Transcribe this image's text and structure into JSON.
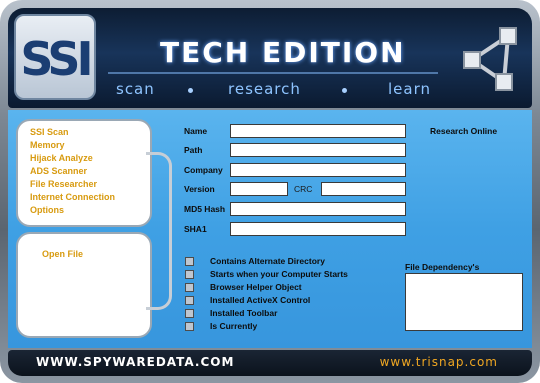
{
  "app": {
    "title": "TECH EDITION",
    "logo_text": "SSI",
    "taglines": [
      "scan",
      "research",
      "learn"
    ]
  },
  "nav": {
    "items": [
      {
        "label": "SSI Scan"
      },
      {
        "label": "Memory"
      },
      {
        "label": "Hijack Analyze"
      },
      {
        "label": "ADS Scanner"
      },
      {
        "label": "File Researcher"
      },
      {
        "label": "Internet Connection"
      },
      {
        "label": "Options"
      }
    ],
    "open_file_label": "Open File"
  },
  "form": {
    "name_label": "Name",
    "name_value": "",
    "path_label": "Path",
    "path_value": "",
    "company_label": "Company",
    "company_value": "",
    "version_label": "Version",
    "version_value": "",
    "crc_label": "CRC",
    "crc_value": "",
    "md5_label": "MD5 Hash",
    "md5_value": "",
    "sha1_label": "SHA1",
    "sha1_value": "",
    "research_online_label": "Research Online"
  },
  "checkboxes": [
    {
      "label": "Contains Alternate Directory",
      "checked": false
    },
    {
      "label": "Starts when your Computer Starts",
      "checked": false
    },
    {
      "label": "Browser Helper Object",
      "checked": false
    },
    {
      "label": "Installed ActiveX Control",
      "checked": false
    },
    {
      "label": "Installed Toolbar",
      "checked": false
    },
    {
      "label": "Is Currently",
      "checked": false
    }
  ],
  "dependency": {
    "label": "File Dependency's"
  },
  "footer": {
    "left_link": "WWW.SPYWAREDATA.COM",
    "right_link": "www.trisnap.com"
  },
  "colors": {
    "accent_orange": "#d89b10",
    "panel_blue": "#3fa0e4",
    "header_navy": "#0d1d33",
    "footer_orange": "#f0a722"
  }
}
